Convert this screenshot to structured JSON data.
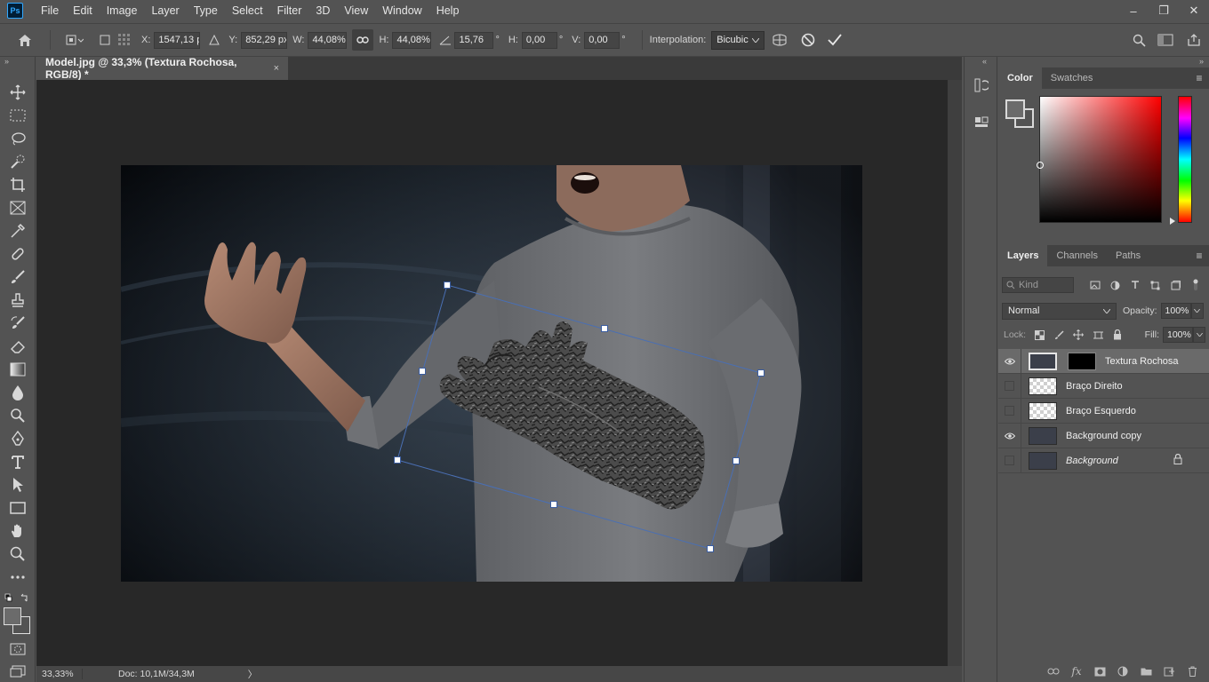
{
  "app": {
    "logo_text": "Ps"
  },
  "menu": {
    "items": [
      "File",
      "Edit",
      "Image",
      "Layer",
      "Type",
      "Select",
      "Filter",
      "3D",
      "View",
      "Window",
      "Help"
    ]
  },
  "window_controls": {
    "minimize": "–",
    "restore": "❐",
    "close": "✕"
  },
  "options_bar": {
    "x_label": "X:",
    "x_value": "1547,13 px",
    "y_label": "Y:",
    "y_value": "852,29 px",
    "w_label": "W:",
    "w_value": "44,08%",
    "h_label": "H:",
    "h_value": "44,08%",
    "angle_value": "15,76",
    "angle_unit": "°",
    "skew_h_label": "H:",
    "skew_h_value": "0,00",
    "skew_h_unit": "°",
    "skew_v_label": "V:",
    "skew_v_value": "0,00",
    "skew_v_unit": "°",
    "interpolation_label": "Interpolation:",
    "interpolation_value": "Bicubic"
  },
  "document": {
    "tab_title": "Model.jpg @ 33,3% (Textura Rochosa, RGB/8) *",
    "close_glyph": "×"
  },
  "status_bar": {
    "zoom": "33,33%",
    "doc_info": "Doc: 10,1M/34,3M",
    "arrow": "〉"
  },
  "color_panel": {
    "tabs": [
      "Color",
      "Swatches"
    ],
    "active_tab": "Color",
    "foreground_color": "#6b6b6b",
    "background_color": "#535353"
  },
  "layers_panel": {
    "tabs": [
      "Layers",
      "Channels",
      "Paths"
    ],
    "active_tab": "Layers",
    "filter_kind_placeholder": "Kind",
    "blend_mode": "Normal",
    "opacity_label": "Opacity:",
    "opacity_value": "100%",
    "lock_label": "Lock:",
    "fill_label": "Fill:",
    "fill_value": "100%",
    "layers": [
      {
        "name": "Textura Rochosa",
        "visible": true,
        "selected": true,
        "has_mask": true,
        "italic": false,
        "locked": false,
        "thumb": "dark"
      },
      {
        "name": "Braço Direito",
        "visible": false,
        "selected": false,
        "has_mask": false,
        "italic": false,
        "locked": false,
        "thumb": "transparent"
      },
      {
        "name": "Braço Esquerdo",
        "visible": false,
        "selected": false,
        "has_mask": false,
        "italic": false,
        "locked": false,
        "thumb": "transparent"
      },
      {
        "name": "Background copy",
        "visible": true,
        "selected": false,
        "has_mask": false,
        "italic": false,
        "locked": false,
        "thumb": "dark"
      },
      {
        "name": "Background",
        "visible": false,
        "selected": false,
        "has_mask": false,
        "italic": true,
        "locked": true,
        "thumb": "dark"
      }
    ]
  },
  "colors": {
    "ps_accent": "#31a8ff",
    "transform_handle": "#ffffff",
    "transform_line": "#4a6fb3"
  }
}
